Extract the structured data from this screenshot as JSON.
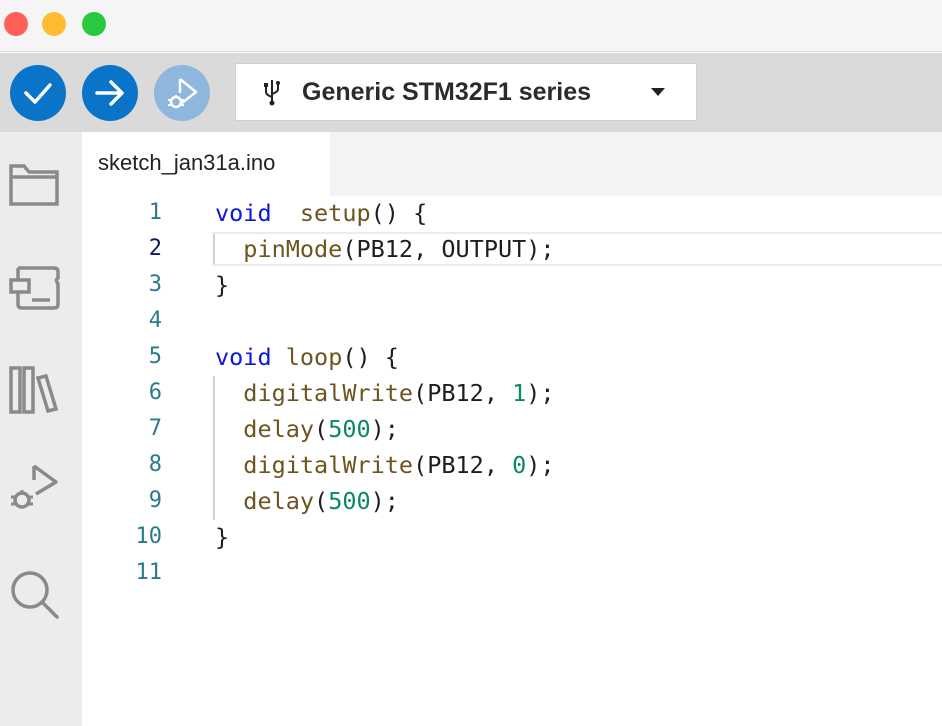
{
  "window": {
    "traffic_lights": {
      "close": "#fe5f57",
      "minimize": "#febc2e",
      "zoom": "#28c840"
    }
  },
  "toolbar": {
    "verify_icon": "check-icon",
    "upload_icon": "arrow-right-icon",
    "debug_icon": "debug-icon",
    "accent": "#0a75c8",
    "board": {
      "icon": "usb-icon",
      "name": "Generic STM32F1 series"
    }
  },
  "sidebar": {
    "items": [
      "folder-icon",
      "board-manager-icon",
      "library-icon",
      "debug-icon",
      "search-icon"
    ]
  },
  "tabs": [
    {
      "label": "sketch_jan31a.ino"
    }
  ],
  "editor": {
    "active_line": 2,
    "lines": [
      {
        "n": "1",
        "tokens": [
          [
            "kw",
            "void"
          ],
          [
            "",
            "  "
          ],
          [
            "fn",
            "setup"
          ],
          [
            "",
            "() {"
          ]
        ]
      },
      {
        "n": "2",
        "tokens": [
          [
            "",
            "  "
          ],
          [
            "fn",
            "pinMode"
          ],
          [
            "",
            "(PB12, OUTPUT);"
          ]
        ]
      },
      {
        "n": "3",
        "tokens": [
          [
            "",
            "}"
          ]
        ]
      },
      {
        "n": "4",
        "tokens": []
      },
      {
        "n": "5",
        "tokens": [
          [
            "kw",
            "void"
          ],
          [
            "",
            " "
          ],
          [
            "fn",
            "loop"
          ],
          [
            "",
            "() {"
          ]
        ]
      },
      {
        "n": "6",
        "tokens": [
          [
            "",
            "  "
          ],
          [
            "fn",
            "digitalWrite"
          ],
          [
            "",
            "(PB12, "
          ],
          [
            "num",
            "1"
          ],
          [
            "",
            ");"
          ]
        ]
      },
      {
        "n": "7",
        "tokens": [
          [
            "",
            "  "
          ],
          [
            "fn",
            "delay"
          ],
          [
            "",
            "("
          ],
          [
            "num",
            "500"
          ],
          [
            "",
            ");"
          ]
        ]
      },
      {
        "n": "8",
        "tokens": [
          [
            "",
            "  "
          ],
          [
            "fn",
            "digitalWrite"
          ],
          [
            "",
            "(PB12, "
          ],
          [
            "num",
            "0"
          ],
          [
            "",
            ");"
          ]
        ]
      },
      {
        "n": "9",
        "tokens": [
          [
            "",
            "  "
          ],
          [
            "fn",
            "delay"
          ],
          [
            "",
            "("
          ],
          [
            "num",
            "500"
          ],
          [
            "",
            ");"
          ]
        ]
      },
      {
        "n": "10",
        "tokens": [
          [
            "",
            "}"
          ]
        ]
      },
      {
        "n": "11",
        "tokens": []
      }
    ]
  }
}
